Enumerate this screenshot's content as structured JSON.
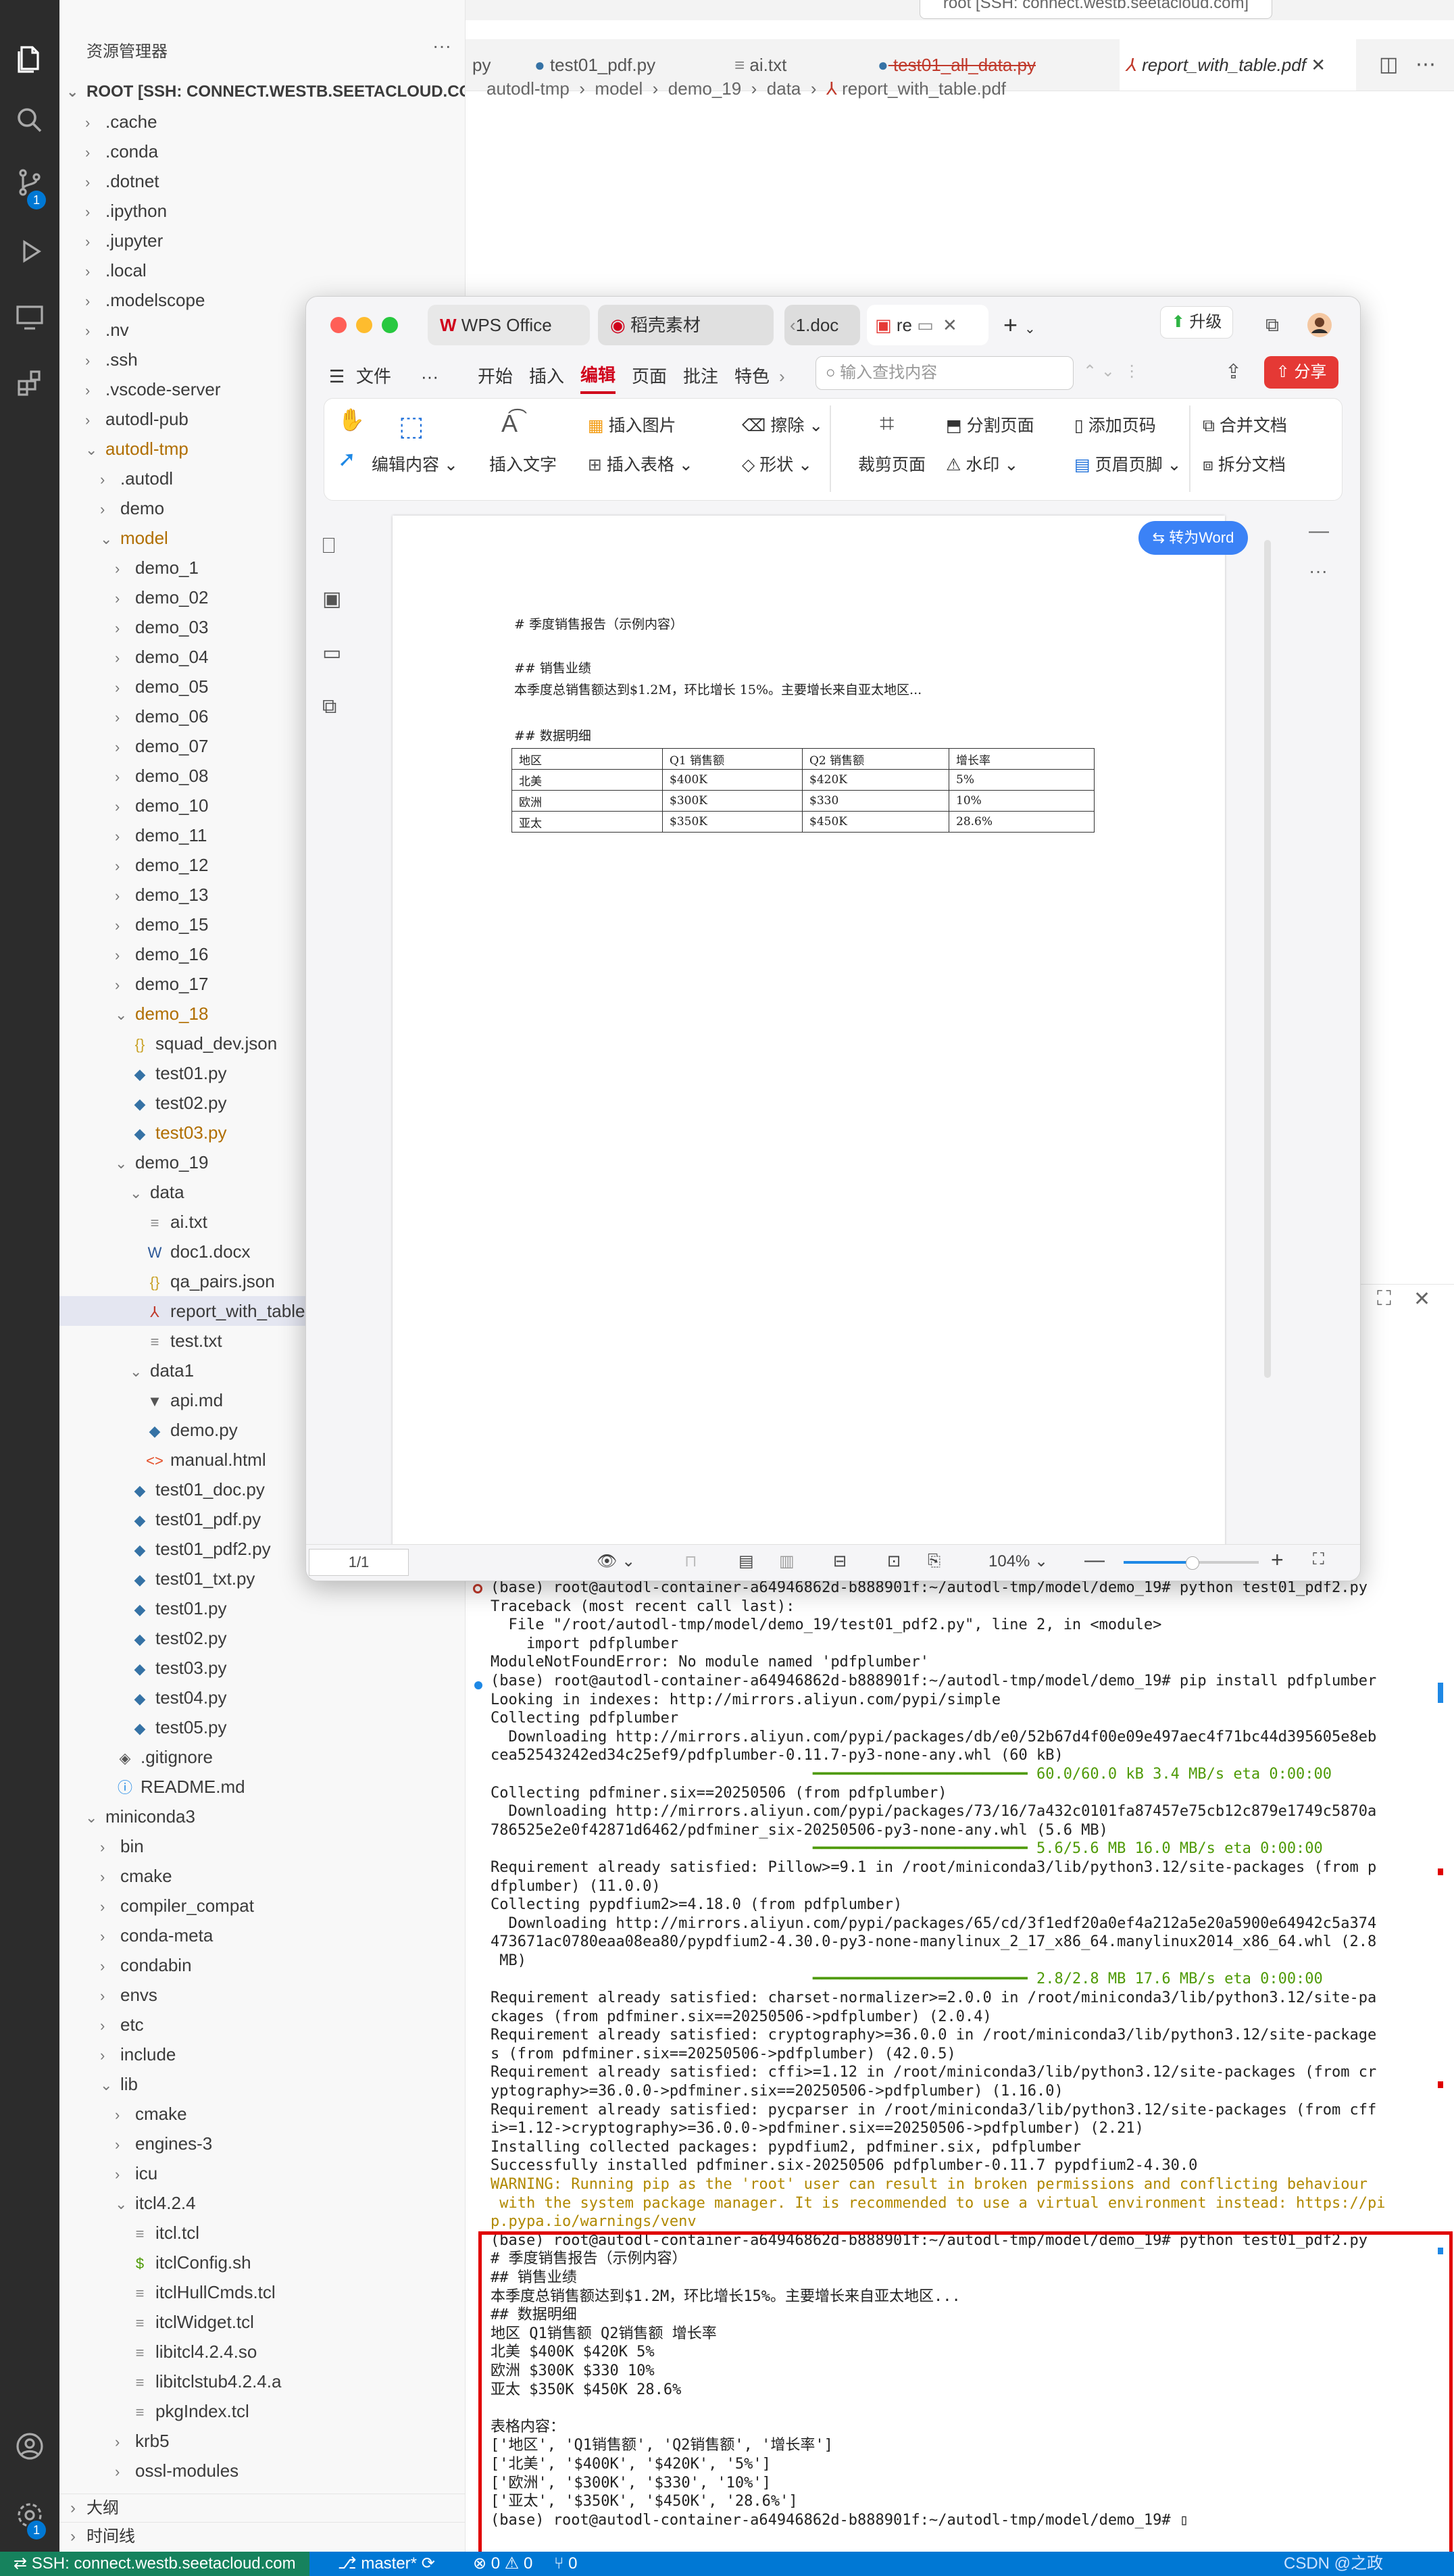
{
  "window": {
    "search_text": "root [SSH: connect.westb.seetacloud.com]"
  },
  "sidebar": {
    "title": "资源管理器",
    "more": "···",
    "root_label": "ROOT [SSH: CONNECT.WESTB.SEETACLOUD.CO...",
    "items": [
      {
        "label": ".cache",
        "indent": 1,
        "kind": "folder",
        "open": false
      },
      {
        "label": ".conda",
        "indent": 1,
        "kind": "folder",
        "open": false
      },
      {
        "label": ".dotnet",
        "indent": 1,
        "kind": "folder",
        "open": false
      },
      {
        "label": ".ipython",
        "indent": 1,
        "kind": "folder",
        "open": false
      },
      {
        "label": ".jupyter",
        "indent": 1,
        "kind": "folder",
        "open": false
      },
      {
        "label": ".local",
        "indent": 1,
        "kind": "folder",
        "open": false
      },
      {
        "label": ".modelscope",
        "indent": 1,
        "kind": "folder",
        "open": false
      },
      {
        "label": ".nv",
        "indent": 1,
        "kind": "folder",
        "open": false
      },
      {
        "label": ".ssh",
        "indent": 1,
        "kind": "folder",
        "open": false
      },
      {
        "label": ".vscode-server",
        "indent": 1,
        "kind": "folder",
        "open": false
      },
      {
        "label": "autodl-pub",
        "indent": 1,
        "kind": "folder",
        "open": false
      },
      {
        "label": "autodl-tmp",
        "indent": 1,
        "kind": "folder",
        "open": true,
        "mod": true
      },
      {
        "label": ".autodl",
        "indent": 2,
        "kind": "folder",
        "open": false
      },
      {
        "label": "demo",
        "indent": 2,
        "kind": "folder",
        "open": false
      },
      {
        "label": "model",
        "indent": 2,
        "kind": "folder",
        "open": true,
        "mod": true
      },
      {
        "label": "demo_1",
        "indent": 3,
        "kind": "folder",
        "open": false
      },
      {
        "label": "demo_02",
        "indent": 3,
        "kind": "folder",
        "open": false
      },
      {
        "label": "demo_03",
        "indent": 3,
        "kind": "folder",
        "open": false
      },
      {
        "label": "demo_04",
        "indent": 3,
        "kind": "folder",
        "open": false
      },
      {
        "label": "demo_05",
        "indent": 3,
        "kind": "folder",
        "open": false
      },
      {
        "label": "demo_06",
        "indent": 3,
        "kind": "folder",
        "open": false
      },
      {
        "label": "demo_07",
        "indent": 3,
        "kind": "folder",
        "open": false
      },
      {
        "label": "demo_08",
        "indent": 3,
        "kind": "folder",
        "open": false
      },
      {
        "label": "demo_10",
        "indent": 3,
        "kind": "folder",
        "open": false
      },
      {
        "label": "demo_11",
        "indent": 3,
        "kind": "folder",
        "open": false
      },
      {
        "label": "demo_12",
        "indent": 3,
        "kind": "folder",
        "open": false
      },
      {
        "label": "demo_13",
        "indent": 3,
        "kind": "folder",
        "open": false
      },
      {
        "label": "demo_15",
        "indent": 3,
        "kind": "folder",
        "open": false
      },
      {
        "label": "demo_16",
        "indent": 3,
        "kind": "folder",
        "open": false
      },
      {
        "label": "demo_17",
        "indent": 3,
        "kind": "folder",
        "open": false
      },
      {
        "label": "demo_18",
        "indent": 3,
        "kind": "folder",
        "open": true,
        "mod": true
      },
      {
        "label": "squad_dev.json",
        "indent": 4,
        "kind": "json"
      },
      {
        "label": "test01.py",
        "indent": 4,
        "kind": "py"
      },
      {
        "label": "test02.py",
        "indent": 4,
        "kind": "py"
      },
      {
        "label": "test03.py",
        "indent": 4,
        "kind": "py",
        "mod": true
      },
      {
        "label": "demo_19",
        "indent": 3,
        "kind": "folder",
        "open": true
      },
      {
        "label": "data",
        "indent": 4,
        "kind": "folder",
        "open": true
      },
      {
        "label": "ai.txt",
        "indent": 5,
        "kind": "txt"
      },
      {
        "label": "doc1.docx",
        "indent": 5,
        "kind": "docx"
      },
      {
        "label": "qa_pairs.json",
        "indent": 5,
        "kind": "json"
      },
      {
        "label": "report_with_table.pdf",
        "indent": 5,
        "kind": "pdf",
        "selected": true
      },
      {
        "label": "test.txt",
        "indent": 5,
        "kind": "txt"
      },
      {
        "label": "data1",
        "indent": 4,
        "kind": "folder",
        "open": true
      },
      {
        "label": "api.md",
        "indent": 5,
        "kind": "md"
      },
      {
        "label": "demo.py",
        "indent": 5,
        "kind": "py"
      },
      {
        "label": "manual.html",
        "indent": 5,
        "kind": "html"
      },
      {
        "label": "test01_doc.py",
        "indent": 4,
        "kind": "py"
      },
      {
        "label": "test01_pdf.py",
        "indent": 4,
        "kind": "py"
      },
      {
        "label": "test01_pdf2.py",
        "indent": 4,
        "kind": "py"
      },
      {
        "label": "test01_txt.py",
        "indent": 4,
        "kind": "py"
      },
      {
        "label": "test01.py",
        "indent": 4,
        "kind": "py"
      },
      {
        "label": "test02.py",
        "indent": 4,
        "kind": "py"
      },
      {
        "label": "test03.py",
        "indent": 4,
        "kind": "py"
      },
      {
        "label": "test04.py",
        "indent": 4,
        "kind": "py"
      },
      {
        "label": "test05.py",
        "indent": 4,
        "kind": "py"
      },
      {
        "label": ".gitignore",
        "indent": 3,
        "kind": "git"
      },
      {
        "label": "README.md",
        "indent": 3,
        "kind": "info"
      },
      {
        "label": "miniconda3",
        "indent": 1,
        "kind": "folder",
        "open": true
      },
      {
        "label": "bin",
        "indent": 2,
        "kind": "folder",
        "open": false
      },
      {
        "label": "cmake",
        "indent": 2,
        "kind": "folder",
        "open": false
      },
      {
        "label": "compiler_compat",
        "indent": 2,
        "kind": "folder",
        "open": false
      },
      {
        "label": "conda-meta",
        "indent": 2,
        "kind": "folder",
        "open": false
      },
      {
        "label": "condabin",
        "indent": 2,
        "kind": "folder",
        "open": false
      },
      {
        "label": "envs",
        "indent": 2,
        "kind": "folder",
        "open": false
      },
      {
        "label": "etc",
        "indent": 2,
        "kind": "folder",
        "open": false
      },
      {
        "label": "include",
        "indent": 2,
        "kind": "folder",
        "open": false
      },
      {
        "label": "lib",
        "indent": 2,
        "kind": "folder",
        "open": true
      },
      {
        "label": "cmake",
        "indent": 3,
        "kind": "folder",
        "open": false
      },
      {
        "label": "engines-3",
        "indent": 3,
        "kind": "folder",
        "open": false
      },
      {
        "label": "icu",
        "indent": 3,
        "kind": "folder",
        "open": false
      },
      {
        "label": "itcl4.2.4",
        "indent": 3,
        "kind": "folder",
        "open": true
      },
      {
        "label": "itcl.tcl",
        "indent": 4,
        "kind": "txt"
      },
      {
        "label": "itclConfig.sh",
        "indent": 4,
        "kind": "sh"
      },
      {
        "label": "itclHullCmds.tcl",
        "indent": 4,
        "kind": "txt"
      },
      {
        "label": "itclWidget.tcl",
        "indent": 4,
        "kind": "txt"
      },
      {
        "label": "libitcl4.2.4.so",
        "indent": 4,
        "kind": "txt"
      },
      {
        "label": "libitclstub4.2.4.a",
        "indent": 4,
        "kind": "txt"
      },
      {
        "label": "pkgIndex.tcl",
        "indent": 4,
        "kind": "txt"
      },
      {
        "label": "krb5",
        "indent": 3,
        "kind": "folder",
        "open": false
      },
      {
        "label": "ossl-modules",
        "indent": 3,
        "kind": "folder",
        "open": false
      }
    ],
    "outline_label": "大纲",
    "timeline_label": "时间线"
  },
  "editor": {
    "tabs": [
      {
        "label": "py",
        "style": "normal"
      },
      {
        "label": "test01_pdf.py",
        "style": "normal"
      },
      {
        "label": "ai.txt",
        "style": "normal"
      },
      {
        "label": "test01_all_data.py",
        "style": "deleted"
      },
      {
        "label": "report_with_table.pdf",
        "style": "active"
      }
    ],
    "breadcrumb": [
      "autodl-tmp",
      "model",
      "demo_19",
      "data",
      "report_with_table.pdf"
    ]
  },
  "wps": {
    "tabs": [
      "WPS Office",
      "稻壳素材",
      "1.doc",
      "re"
    ],
    "upgrade_label": "升级",
    "menu": [
      "文件",
      "···",
      "开始",
      "插入",
      "编辑",
      "页面",
      "批注",
      "特色"
    ],
    "active_menu": "编辑",
    "search_placeholder": "输入查找内容",
    "share_label": "分享",
    "ribbon": {
      "edit_content": "编辑内容",
      "insert_text": "插入文字",
      "insert_image": "插入图片",
      "insert_table": "插入表格",
      "erase": "擦除",
      "shape": "形状",
      "crop_page": "裁剪页面",
      "split_page": "分割页面",
      "watermark": "水印",
      "add_page_number": "添加页码",
      "header_footer": "页眉页脚",
      "merge_doc": "合并文档",
      "split_doc": "拆分文档"
    },
    "to_word_label": "转为Word",
    "page_indicator": "1/1",
    "zoom": "104%",
    "document": {
      "title": "# 季度销售报告（示例内容）",
      "h2_sales": "## 销售业绩",
      "paragraph": "本季度总销售额达到$1.2M，环比增长 15%。主要增长来自亚太地区...",
      "h2_detail": "## 数据明细",
      "table": {
        "headers": [
          "地区",
          "Q1 销售额",
          "Q2 销售额",
          "增长率"
        ],
        "rows": [
          [
            "北美",
            "$400K",
            "$420K",
            "5%"
          ],
          [
            "欧洲",
            "$300K",
            "$330",
            "10%"
          ],
          [
            "亚太",
            "$350K",
            "$450K",
            "28.6%"
          ]
        ]
      }
    }
  },
  "terminal": {
    "lines": [
      {
        "t": "(base) root@autodl-container-a64946862d-b888901f:~/autodl-tmp/model/demo_19# python test01_pdf2.py",
        "c": "",
        "dot": "red"
      },
      {
        "t": "Traceback (most recent call last):",
        "c": ""
      },
      {
        "t": "  File \"/root/autodl-tmp/model/demo_19/test01_pdf2.py\", line 2, in <module>",
        "c": ""
      },
      {
        "t": "    import pdfplumber",
        "c": ""
      },
      {
        "t": "ModuleNotFoundError: No module named 'pdfplumber'",
        "c": ""
      },
      {
        "t": "(base) root@autodl-container-a64946862d-b888901f:~/autodl-tmp/model/demo_19# pip install pdfplumber",
        "c": "",
        "dot": "blue"
      },
      {
        "t": "Looking in indexes: http://mirrors.aliyun.com/pypi/simple",
        "c": ""
      },
      {
        "t": "Collecting pdfplumber",
        "c": ""
      },
      {
        "t": "  Downloading http://mirrors.aliyun.com/pypi/packages/db/e0/52b67d4f00e09e497aec4f71bc44d395605e8eb",
        "c": ""
      },
      {
        "t": "cea52543242ed34c25ef9/pdfplumber-0.11.7-py3-none-any.whl (60 kB)",
        "c": ""
      },
      {
        "t": "                                    ━━━━━━━━━━━━━━━━━━━━━━━━ 60.0/60.0 kB 3.4 MB/s eta 0:00:00",
        "c": "bar"
      },
      {
        "t": "Collecting pdfminer.six==20250506 (from pdfplumber)",
        "c": ""
      },
      {
        "t": "  Downloading http://mirrors.aliyun.com/pypi/packages/73/16/7a432c0101fa87457e75cb12c879e1749c5870a",
        "c": ""
      },
      {
        "t": "786525e2e0f42871d6462/pdfminer_six-20250506-py3-none-any.whl (5.6 MB)",
        "c": ""
      },
      {
        "t": "                                    ━━━━━━━━━━━━━━━━━━━━━━━━ 5.6/5.6 MB 16.0 MB/s eta 0:00:00",
        "c": "bar"
      },
      {
        "t": "Requirement already satisfied: Pillow>=9.1 in /root/miniconda3/lib/python3.12/site-packages (from p",
        "c": ""
      },
      {
        "t": "dfplumber) (11.0.0)",
        "c": ""
      },
      {
        "t": "Collecting pypdfium2>=4.18.0 (from pdfplumber)",
        "c": ""
      },
      {
        "t": "  Downloading http://mirrors.aliyun.com/pypi/packages/65/cd/3f1edf20a0ef4a212a5e20a5900e64942c5a374",
        "c": ""
      },
      {
        "t": "473671ac0780eaa08ea80/pypdfium2-4.30.0-py3-none-manylinux_2_17_x86_64.manylinux2014_x86_64.whl (2.8",
        "c": ""
      },
      {
        "t": " MB)",
        "c": ""
      },
      {
        "t": "                                    ━━━━━━━━━━━━━━━━━━━━━━━━ 2.8/2.8 MB 17.6 MB/s eta 0:00:00",
        "c": "bar"
      },
      {
        "t": "Requirement already satisfied: charset-normalizer>=2.0.0 in /root/miniconda3/lib/python3.12/site-pa",
        "c": ""
      },
      {
        "t": "ckages (from pdfminer.six==20250506->pdfplumber) (2.0.4)",
        "c": ""
      },
      {
        "t": "Requirement already satisfied: cryptography>=36.0.0 in /root/miniconda3/lib/python3.12/site-package",
        "c": ""
      },
      {
        "t": "s (from pdfminer.six==20250506->pdfplumber) (42.0.5)",
        "c": ""
      },
      {
        "t": "Requirement already satisfied: cffi>=1.12 in /root/miniconda3/lib/python3.12/site-packages (from cr",
        "c": ""
      },
      {
        "t": "yptography>=36.0.0->pdfminer.six==20250506->pdfplumber) (1.16.0)",
        "c": ""
      },
      {
        "t": "Requirement already satisfied: pycparser in /root/miniconda3/lib/python3.12/site-packages (from cff",
        "c": ""
      },
      {
        "t": "i>=1.12->cryptography>=36.0.0->pdfminer.six==20250506->pdfplumber) (2.21)",
        "c": ""
      },
      {
        "t": "Installing collected packages: pypdfium2, pdfminer.six, pdfplumber",
        "c": ""
      },
      {
        "t": "Successfully installed pdfminer.six-20250506 pdfplumber-0.11.7 pypdfium2-4.30.0",
        "c": ""
      },
      {
        "t": "WARNING: Running pip as the 'root' user can result in broken permissions and conflicting behaviour",
        "c": "warn"
      },
      {
        "t": " with the system package manager. It is recommended to use a virtual environment instead: https://pi",
        "c": "warn"
      },
      {
        "t": "p.pypa.io/warnings/venv",
        "c": "warn"
      },
      {
        "t": "(base) root@autodl-container-a64946862d-b888901f:~/autodl-tmp/model/demo_19# python test01_pdf2.py",
        "c": ""
      },
      {
        "t": "# 季度销售报告（示例内容）",
        "c": ""
      },
      {
        "t": "## 销售业绩",
        "c": ""
      },
      {
        "t": "本季度总销售额达到$1.2M，环比增长15%。主要增长来自亚太地区...",
        "c": ""
      },
      {
        "t": "## 数据明细",
        "c": ""
      },
      {
        "t": "地区 Q1销售额 Q2销售额 增长率",
        "c": ""
      },
      {
        "t": "北美 $400K $420K 5%",
        "c": ""
      },
      {
        "t": "欧洲 $300K $330 10%",
        "c": ""
      },
      {
        "t": "亚太 $350K $450K 28.6%",
        "c": ""
      },
      {
        "t": "",
        "c": ""
      },
      {
        "t": "表格内容：",
        "c": ""
      },
      {
        "t": "['地区', 'Q1销售额', 'Q2销售额', '增长率']",
        "c": ""
      },
      {
        "t": "['北美', '$400K', '$420K', '5%']",
        "c": ""
      },
      {
        "t": "['欧洲', '$300K', '$330', '10%']",
        "c": ""
      },
      {
        "t": "['亚太', '$350K', '$450K', '28.6%']",
        "c": ""
      },
      {
        "t": "(base) root@autodl-container-a64946862d-b888901f:~/autodl-tmp/model/demo_19# ▯",
        "c": ""
      }
    ]
  },
  "statusbar": {
    "ssh": "SSH: connect.westb.seetacloud.com",
    "branch": "master*",
    "problems": "⊗ 0 ⚠ 0",
    "ports": "⑂ 0",
    "watermark": "CSDN @之政"
  },
  "colors": {
    "status_blue": "#0078d4",
    "ssh_green": "#16825d",
    "activity_bg": "#2c2c2c",
    "wps_red": "#e53935",
    "highlight_frame": "#e00000"
  }
}
